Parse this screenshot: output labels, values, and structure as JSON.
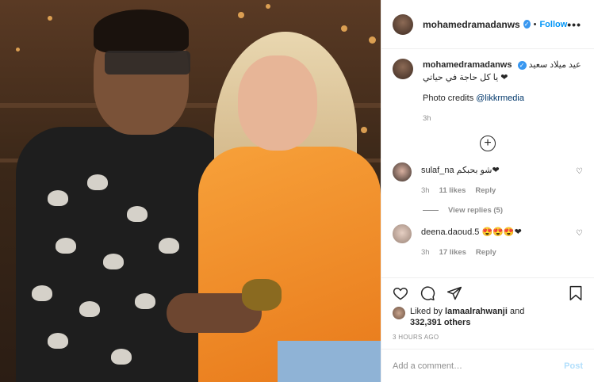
{
  "post": {
    "username": "mohamedramadanws",
    "follow_label": "Follow",
    "more_label": "•••"
  },
  "caption": {
    "username": "mohamedramadanws",
    "text_line1": "عيد ميلاد سعيد",
    "text_line2": "يا كل حاجة في حياتي ❤",
    "credits_prefix": "Photo credits ",
    "credits_handle": "@likkrmedia",
    "time": "3h"
  },
  "comments": [
    {
      "username": "sulaf_na",
      "text": "شو بحبكم❤",
      "time": "3h",
      "likes": "11 likes",
      "reply": "Reply"
    },
    {
      "username": "deena.daoud.5",
      "text": "😍😍😍❤",
      "time": "3h",
      "likes": "17 likes",
      "reply": "Reply"
    }
  ],
  "view_replies": "View replies (5)",
  "likes": {
    "prefix": "Liked by ",
    "user": "lamaalrahwanji",
    "and": " and",
    "count": "332,391 others"
  },
  "timestamp": "3 HOURS AGO",
  "add_comment": {
    "placeholder": "Add a comment…",
    "post_label": "Post"
  },
  "colors": {
    "accent": "#0095f6",
    "verified": "#3897f0",
    "muted": "#8e8e8e"
  },
  "icons": [
    "heart-icon",
    "comment-icon",
    "share-icon",
    "bookmark-icon",
    "add-circle-icon",
    "verified-badge-icon"
  ]
}
